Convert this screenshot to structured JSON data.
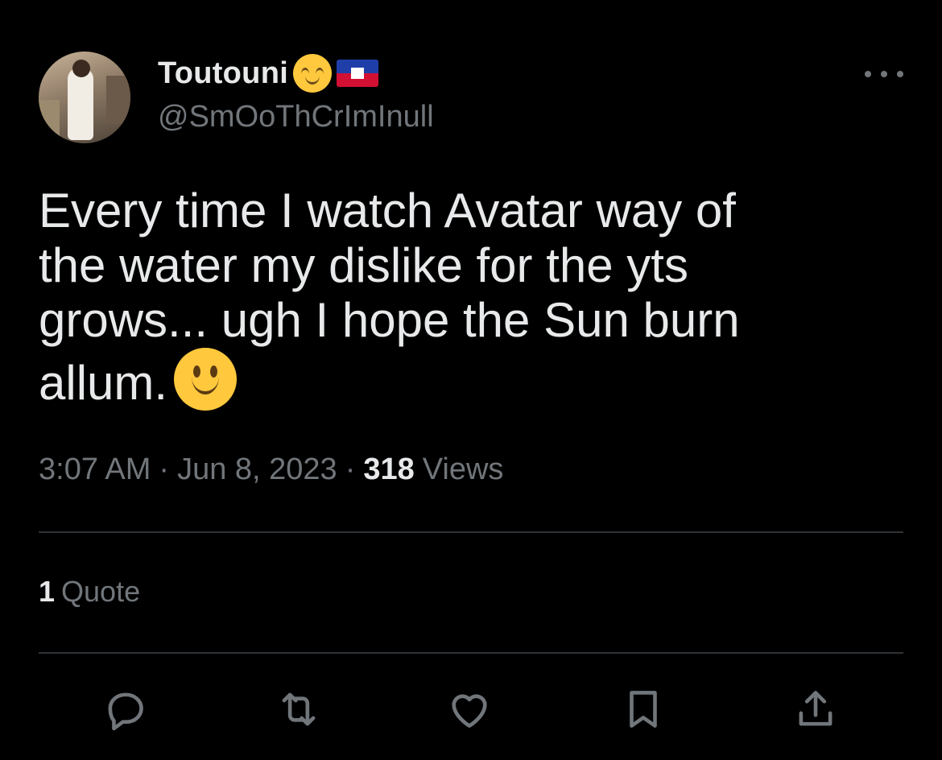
{
  "user": {
    "display_name": "Toutouni",
    "handle": "@SmOoThCrImInull",
    "emoji_icon": "relieved-face-emoji",
    "flag_icon": "haiti-flag"
  },
  "tweet": {
    "text": "Every time I watch Avatar way of\nthe water my dislike for the yts\ngrows... ugh I hope the Sun burn\nallum.",
    "emoji_icon": "slightly-smiling-face-emoji"
  },
  "meta": {
    "time": "3:07 AM",
    "date": "Jun 8, 2023",
    "separator": "·",
    "views_count": "318",
    "views_label": "Views"
  },
  "stats": {
    "quotes_count": "1",
    "quotes_label": "Quote"
  },
  "actions": [
    "reply-icon",
    "retweet-icon",
    "like-icon",
    "bookmark-icon",
    "share-icon"
  ],
  "colors": {
    "background": "#000000",
    "text": "#e7e9ea",
    "secondary": "#71767b",
    "divider": "#2f3336"
  }
}
